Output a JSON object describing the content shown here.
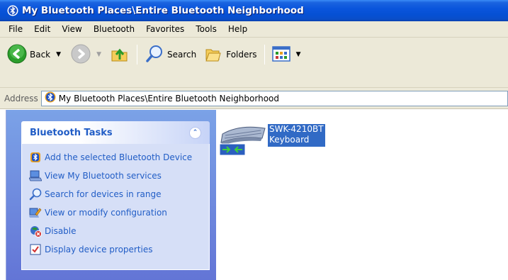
{
  "window": {
    "title": "My Bluetooth Places\\Entire Bluetooth Neighborhood",
    "accent": "#0a55dc"
  },
  "menu": {
    "items": [
      "File",
      "Edit",
      "View",
      "Bluetooth",
      "Favorites",
      "Tools",
      "Help"
    ]
  },
  "toolbar": {
    "back_label": "Back",
    "search_label": "Search",
    "folders_label": "Folders",
    "icons": [
      "back-arrow-icon",
      "forward-arrow-icon",
      "up-folder-icon",
      "search-icon",
      "folders-icon",
      "views-icon"
    ]
  },
  "address": {
    "label": "Address",
    "value": "My Bluetooth Places\\Entire Bluetooth Neighborhood"
  },
  "tasks": {
    "title": "Bluetooth Tasks",
    "items": [
      {
        "label": "Add the selected Bluetooth Device",
        "icon": "bluetooth-icon"
      },
      {
        "label": "View My Bluetooth services",
        "icon": "computer-icon"
      },
      {
        "label": "Search for devices in range",
        "icon": "search-icon"
      },
      {
        "label": "View or modify configuration",
        "icon": "config-icon"
      },
      {
        "label": "Disable",
        "icon": "disable-icon"
      },
      {
        "label": "Display device properties",
        "icon": "properties-icon"
      }
    ]
  },
  "device": {
    "name": "SWK-4210BT",
    "type": "Keyboard",
    "icon": "keyboard-icon",
    "selection_color": "#316ac5"
  }
}
